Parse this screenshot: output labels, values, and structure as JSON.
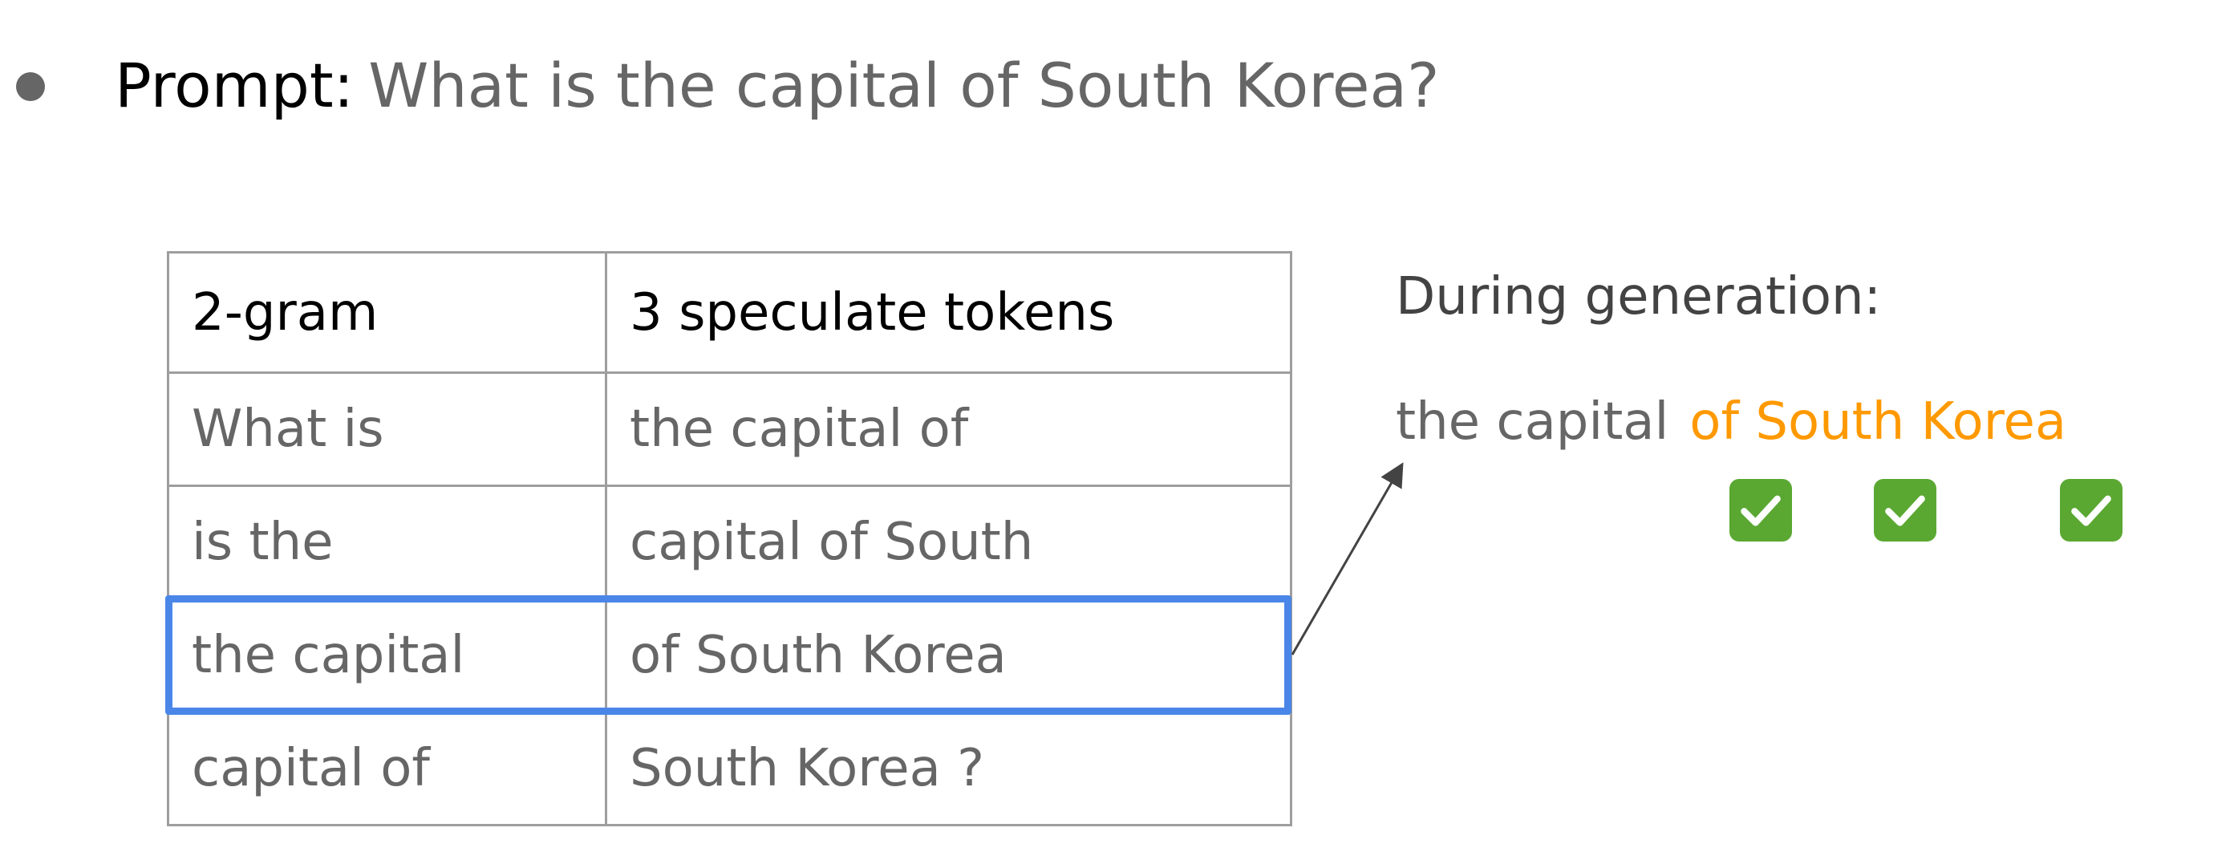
{
  "prompt": {
    "label": "Prompt:",
    "question": "What is the capital of South Korea?"
  },
  "table": {
    "headers": [
      "2-gram",
      "3 speculate tokens"
    ],
    "rows": [
      [
        "What is",
        "the capital of"
      ],
      [
        "is the",
        "capital of South"
      ],
      [
        "the capital",
        "of South Korea"
      ],
      [
        "capital of",
        "South Korea ?"
      ]
    ],
    "highlighted_row": "the capital"
  },
  "generation": {
    "title": "During generation:",
    "context": "the capital",
    "speculated": "of South Korea",
    "checks": [
      "check-icon",
      "check-icon",
      "check-icon"
    ]
  },
  "colors": {
    "prompt_label": "#000000",
    "prompt_question": "#666666",
    "header_text": "#000000",
    "cell_text": "#666666",
    "title_text": "#434343",
    "speculated": "#ff9900",
    "highlight": "#4a86e8",
    "check_bg": "#5aa832",
    "bullet": "#666666"
  }
}
